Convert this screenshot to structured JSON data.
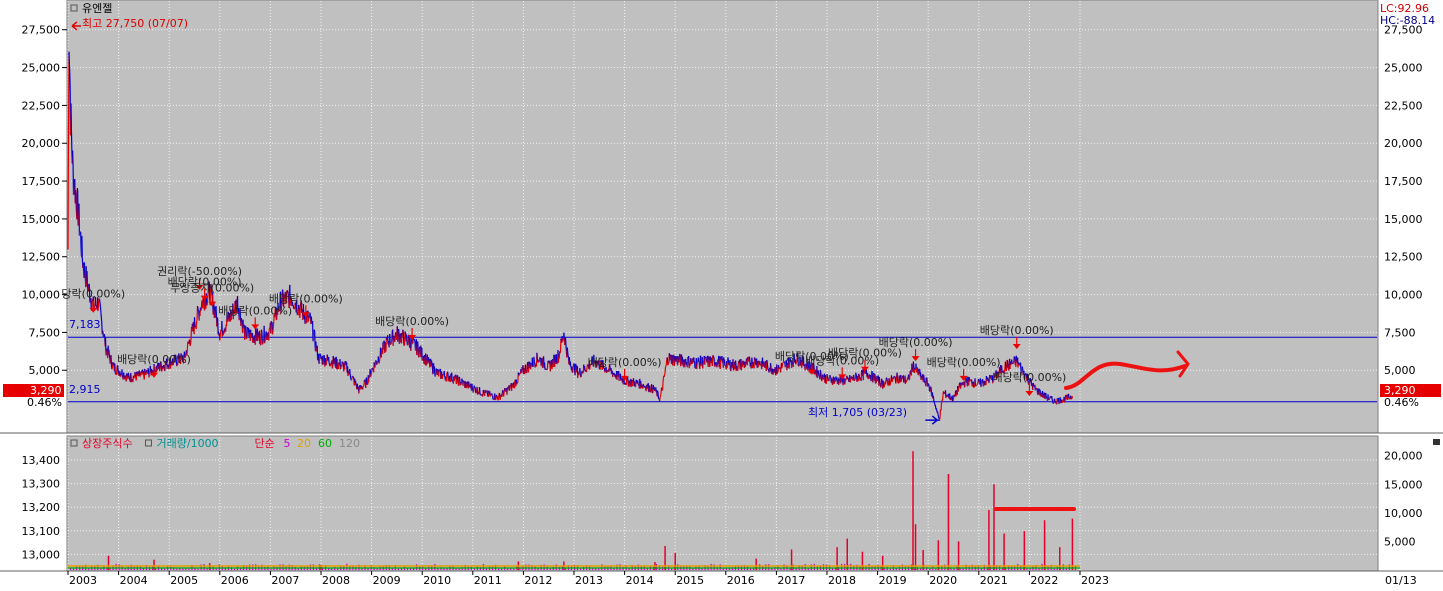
{
  "chart_data": [
    {
      "type": "line",
      "title": "유엔젤",
      "y_ticks": [
        "27,500",
        "25,000",
        "22,500",
        "20,000",
        "17,500",
        "15,000",
        "12,500",
        "10,000",
        "7,500",
        "5,000"
      ],
      "ylim": [
        1000,
        28600
      ],
      "x_ticks": [
        "2003",
        "2004",
        "2005",
        "2006",
        "2007",
        "2008",
        "2009",
        "2010",
        "2011",
        "2012",
        "2013",
        "2014",
        "2015",
        "2016",
        "2017",
        "2018",
        "2019",
        "2020",
        "2021",
        "2022",
        "2023"
      ],
      "x_end_label": "01/13",
      "indicators": {
        "lc": "LC:92.96",
        "hc": "HC:-88.14"
      },
      "high": {
        "text": "최고 27,750 (07/07)",
        "year": 2003.02,
        "value": 27750
      },
      "low": {
        "text": "최저 1,705 (03/23)",
        "year": 2020.22,
        "value": 1705
      },
      "current": {
        "label": "3,290",
        "pct": "0.46%",
        "value": 3290
      },
      "hlines": [
        {
          "label": "7,183",
          "value": 7183
        },
        {
          "label": "2,915",
          "value": 2915
        }
      ],
      "events": [
        {
          "text": "당락(0.00%)",
          "year": 2003.5,
          "value": 8800
        },
        {
          "text": "배당락(0.00%)",
          "year": 2004.7,
          "value": 4500
        },
        {
          "text": "권리락(-50.00%)",
          "year": 2005.6,
          "value": 10300
        },
        {
          "text": "배당락(0.00%)",
          "year": 2005.7,
          "value": 9600
        },
        {
          "text": "무상증자(0.00%)",
          "year": 2005.85,
          "value": 9200
        },
        {
          "text": "배당락(0.00%)",
          "year": 2006.7,
          "value": 7700
        },
        {
          "text": "배당락(0.00%)",
          "year": 2007.7,
          "value": 8500
        },
        {
          "text": "배당락(0.00%)",
          "year": 2009.8,
          "value": 7000
        },
        {
          "text": "배당락(0.00%)",
          "year": 2014.0,
          "value": 4300
        },
        {
          "text": "배당락(0.00%)",
          "year": 2017.7,
          "value": 4700
        },
        {
          "text": "배당락(0.00%)",
          "year": 2018.3,
          "value": 4400
        },
        {
          "text": "배당락(0.00%)",
          "year": 2018.75,
          "value": 4900
        },
        {
          "text": "배당락(0.00%)",
          "year": 2019.75,
          "value": 5600
        },
        {
          "text": "배당락(0.00%)",
          "year": 2020.7,
          "value": 4300
        },
        {
          "text": "배당락(0.00%)",
          "year": 2021.75,
          "value": 6400
        },
        {
          "text": "배당락(0.00%)",
          "year": 2022.0,
          "value": 3300
        }
      ],
      "series_keyframes": [
        [
          2003.0,
          13000
        ],
        [
          2003.02,
          27750
        ],
        [
          2003.05,
          22000
        ],
        [
          2003.1,
          18000
        ],
        [
          2003.2,
          15500
        ],
        [
          2003.3,
          12000
        ],
        [
          2003.4,
          10500
        ],
        [
          2003.5,
          9200
        ],
        [
          2003.6,
          9500
        ],
        [
          2003.75,
          6500
        ],
        [
          2003.9,
          5200
        ],
        [
          2004.0,
          5000
        ],
        [
          2004.2,
          4500
        ],
        [
          2004.5,
          4700
        ],
        [
          2004.8,
          5200
        ],
        [
          2005.0,
          5500
        ],
        [
          2005.3,
          5800
        ],
        [
          2005.5,
          8000
        ],
        [
          2005.65,
          9500
        ],
        [
          2005.8,
          10200
        ],
        [
          2005.9,
          9000
        ],
        [
          2006.0,
          7500
        ],
        [
          2006.2,
          8500
        ],
        [
          2006.35,
          9500
        ],
        [
          2006.5,
          7400
        ],
        [
          2006.8,
          7200
        ],
        [
          2007.0,
          7600
        ],
        [
          2007.2,
          9500
        ],
        [
          2007.4,
          9900
        ],
        [
          2007.6,
          9000
        ],
        [
          2007.8,
          8200
        ],
        [
          2007.95,
          5800
        ],
        [
          2008.2,
          5600
        ],
        [
          2008.5,
          5200
        ],
        [
          2008.75,
          3700
        ],
        [
          2008.9,
          4200
        ],
        [
          2009.0,
          5000
        ],
        [
          2009.3,
          6800
        ],
        [
          2009.5,
          7400
        ],
        [
          2009.7,
          7000
        ],
        [
          2009.9,
          6500
        ],
        [
          2010.1,
          5600
        ],
        [
          2010.3,
          4800
        ],
        [
          2010.6,
          4500
        ],
        [
          2010.9,
          4000
        ],
        [
          2011.2,
          3500
        ],
        [
          2011.5,
          3200
        ],
        [
          2011.8,
          4000
        ],
        [
          2012.0,
          5000
        ],
        [
          2012.3,
          5800
        ],
        [
          2012.5,
          5200
        ],
        [
          2012.7,
          6000
        ],
        [
          2012.8,
          7500
        ],
        [
          2012.9,
          5500
        ],
        [
          2013.1,
          4800
        ],
        [
          2013.4,
          5600
        ],
        [
          2013.7,
          5000
        ],
        [
          2014.0,
          4300
        ],
        [
          2014.3,
          4100
        ],
        [
          2014.6,
          3700
        ],
        [
          2014.7,
          3100
        ],
        [
          2014.75,
          3900
        ],
        [
          2014.85,
          5800
        ],
        [
          2015.0,
          5700
        ],
        [
          2015.4,
          5500
        ],
        [
          2015.8,
          5600
        ],
        [
          2016.2,
          5300
        ],
        [
          2016.6,
          5600
        ],
        [
          2017.0,
          5000
        ],
        [
          2017.4,
          5800
        ],
        [
          2017.8,
          4900
        ],
        [
          2018.0,
          4400
        ],
        [
          2018.4,
          4300
        ],
        [
          2018.8,
          4800
        ],
        [
          2019.1,
          4100
        ],
        [
          2019.4,
          4500
        ],
        [
          2019.6,
          4300
        ],
        [
          2019.7,
          5300
        ],
        [
          2019.9,
          4400
        ],
        [
          2020.0,
          4100
        ],
        [
          2020.1,
          3200
        ],
        [
          2020.22,
          1705
        ],
        [
          2020.3,
          3500
        ],
        [
          2020.5,
          3100
        ],
        [
          2020.6,
          3800
        ],
        [
          2020.75,
          4300
        ],
        [
          2021.0,
          4100
        ],
        [
          2021.3,
          4500
        ],
        [
          2021.5,
          5200
        ],
        [
          2021.75,
          5600
        ],
        [
          2021.9,
          4800
        ],
        [
          2022.1,
          3800
        ],
        [
          2022.3,
          3300
        ],
        [
          2022.5,
          2950
        ],
        [
          2022.7,
          3100
        ],
        [
          2022.85,
          3290
        ]
      ]
    },
    {
      "type": "bar",
      "legend": [
        {
          "name": "상장주식수",
          "color": "#e8002a"
        },
        {
          "name": "거래량/1000",
          "color": "#009090"
        },
        {
          "name": "단순",
          "color": "#e8002a"
        },
        {
          "name": "5",
          "color": "#cc00cc"
        },
        {
          "name": "20",
          "color": "#e0a000"
        },
        {
          "name": "60",
          "color": "#00aa00"
        },
        {
          "name": "120",
          "color": "#888888"
        }
      ],
      "y_left_ticks": [
        "13,400",
        "13,300",
        "13,200",
        "13,100",
        "13,000"
      ],
      "y_right_ticks": [
        "20,000",
        "15,000",
        "10,000",
        "5,000"
      ],
      "ylim_right": [
        0,
        23000
      ],
      "volume_spikes": [
        [
          2003.8,
          2500
        ],
        [
          2004.7,
          1800
        ],
        [
          2005.8,
          1200
        ],
        [
          2008.0,
          900
        ],
        [
          2011.9,
          1500
        ],
        [
          2012.8,
          1500
        ],
        [
          2014.6,
          1400
        ],
        [
          2014.8,
          4200
        ],
        [
          2015.0,
          3000
        ],
        [
          2016.6,
          2000
        ],
        [
          2017.3,
          3600
        ],
        [
          2018.2,
          4000
        ],
        [
          2018.4,
          5500
        ],
        [
          2018.7,
          3200
        ],
        [
          2019.1,
          2500
        ],
        [
          2019.7,
          20800
        ],
        [
          2019.75,
          8000
        ],
        [
          2019.9,
          3500
        ],
        [
          2020.2,
          5200
        ],
        [
          2020.4,
          16800
        ],
        [
          2020.6,
          5000
        ],
        [
          2021.2,
          10500
        ],
        [
          2021.3,
          15000
        ],
        [
          2021.5,
          6400
        ],
        [
          2021.9,
          6800
        ],
        [
          2022.3,
          8700
        ],
        [
          2022.6,
          4000
        ],
        [
          2022.85,
          9000
        ]
      ]
    }
  ]
}
